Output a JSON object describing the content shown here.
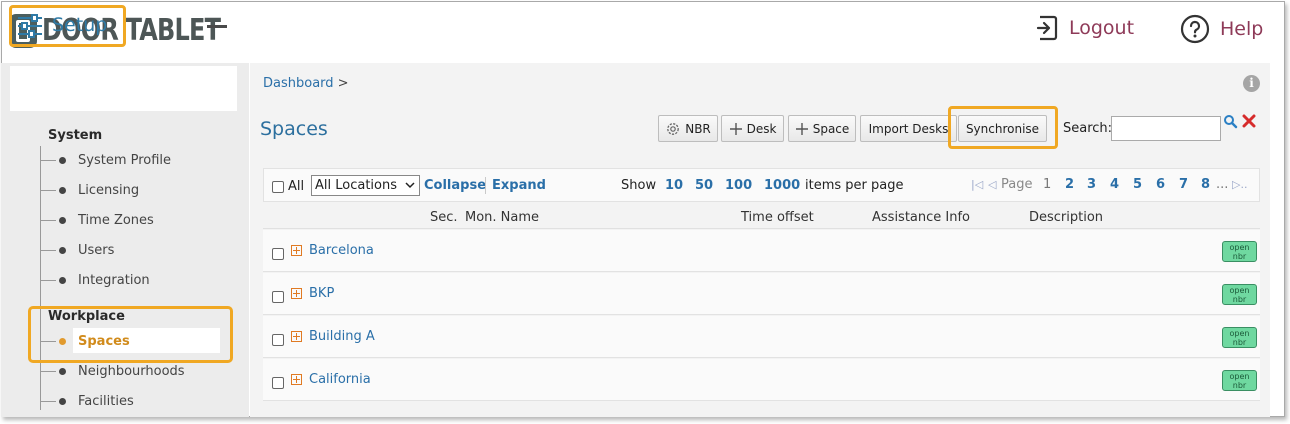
{
  "header": {
    "brand": "DOOR TABLET",
    "logout_label": "Logout",
    "help_label": "Help",
    "accent_color": "#8e3a58"
  },
  "sidebar": {
    "setup_label": "Setup",
    "system_title": "System",
    "system_items": [
      "System Profile",
      "Licensing",
      "Time Zones",
      "Users",
      "Integration"
    ],
    "workplace_title": "Workplace",
    "workplace_items": [
      "Spaces",
      "Neighbourhoods",
      "Facilities"
    ],
    "active_item": "Spaces",
    "highlight_color": "#f0a823"
  },
  "main": {
    "breadcrumb": "Dashboard",
    "breadcrumb_sep": ">",
    "title": "Spaces",
    "toolbar": {
      "nbr_label": "NBR",
      "desk_label": "Desk",
      "space_label": "Space",
      "import_label": "Import Desks",
      "sync_label": "Synchronise",
      "search_label": "Search:",
      "search_value": ""
    },
    "listbar": {
      "all_label": "All",
      "location_select": "All Locations",
      "collapse_label": "Collapse",
      "expand_label": "Expand",
      "show_label": "Show",
      "page_sizes": [
        "10",
        "50",
        "100",
        "1000"
      ],
      "per_page_label": "items per page",
      "page_label": "Page",
      "pages": [
        "1",
        "2",
        "3",
        "4",
        "5",
        "6",
        "7",
        "8"
      ],
      "current_page": "1",
      "ellipsis": "..."
    },
    "columns": {
      "sec": "Sec.",
      "mon_name": "Mon. Name",
      "time_offset": "Time offset",
      "assistance": "Assistance Info",
      "description": "Description"
    },
    "rows": [
      {
        "name": "Barcelona",
        "badge_top": "open",
        "badge_bottom": "nbr"
      },
      {
        "name": "BKP",
        "badge_top": "open",
        "badge_bottom": "nbr"
      },
      {
        "name": "Building A",
        "badge_top": "open",
        "badge_bottom": "nbr"
      },
      {
        "name": "California",
        "badge_top": "open",
        "badge_bottom": "nbr"
      }
    ]
  }
}
